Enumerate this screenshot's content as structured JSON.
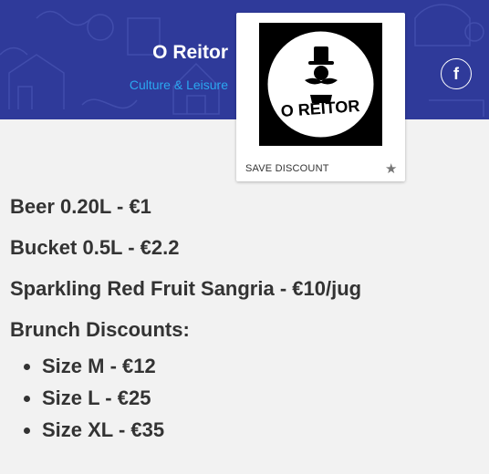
{
  "header": {
    "title": "O Reitor",
    "category": "Culture & Leisure",
    "social_icon": "facebook-icon",
    "background_color": "#2f3a9a",
    "category_color": "#2ba7f0"
  },
  "card": {
    "logo_text": "O REITOR",
    "save_label": "SAVE DISCOUNT",
    "save_icon": "star-icon"
  },
  "offers": [
    "Beer 0.20L - €1",
    "Bucket 0.5L - €2.2",
    "Sparkling Red Fruit Sangria - €10/jug",
    "Brunch Discounts:"
  ],
  "brunch_items": [
    "Size M - €12",
    "Size L - €25",
    "Size XL - €35"
  ]
}
